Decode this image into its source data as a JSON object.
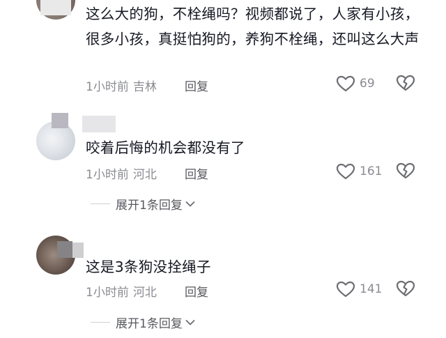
{
  "comments": [
    {
      "text": "这么大的狗，不栓绳吗？视频都说了，人家有小孩，很多小孩，真挺怕狗的，养狗不栓绳，还叫这么大声",
      "time": "1小时前",
      "location": "吉林",
      "reply_label": "回复",
      "likes": "69"
    },
    {
      "text": "咬着后悔的机会都没有了",
      "time": "1小时前",
      "location": "河北",
      "reply_label": "回复",
      "likes": "161",
      "expand_label": "展开1条回复"
    },
    {
      "text": "这是3条狗没拴绳子",
      "time": "1小时前",
      "location": "河北",
      "reply_label": "回复",
      "likes": "141",
      "expand_label": "展开1条回复"
    }
  ],
  "icons": {
    "like": "heart-outline-icon",
    "dislike": "broken-heart-icon",
    "expand": "chevron-down-icon"
  },
  "colors": {
    "text": "#161823",
    "meta": "#8a8b91",
    "reply": "#58595f"
  }
}
